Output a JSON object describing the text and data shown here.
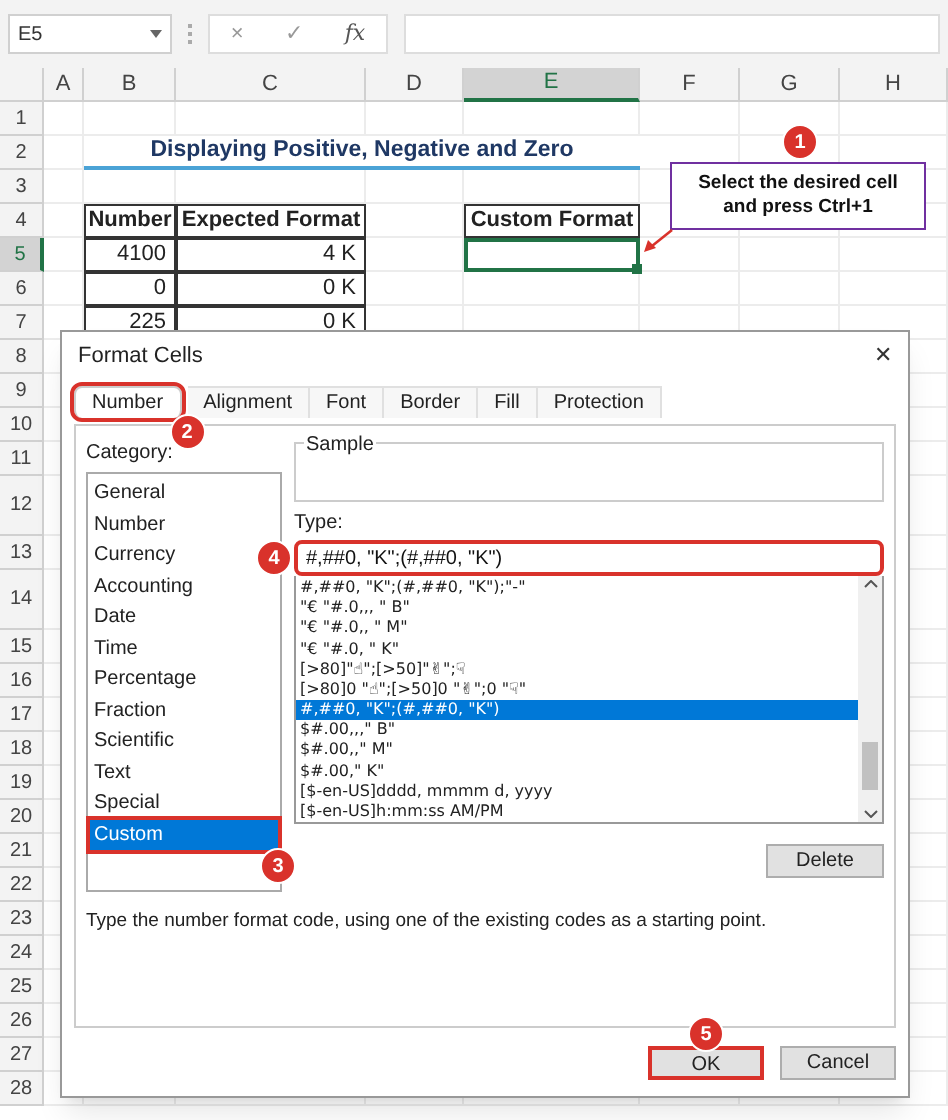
{
  "formula_bar": {
    "name_box": "E5",
    "cancel": "×",
    "enter": "✓",
    "function": "fx"
  },
  "sheet": {
    "columns": [
      {
        "label": "A",
        "selected": false
      },
      {
        "label": "B",
        "selected": false
      },
      {
        "label": "C",
        "selected": false
      },
      {
        "label": "D",
        "selected": false
      },
      {
        "label": "E",
        "selected": true
      },
      {
        "label": "F",
        "selected": false
      },
      {
        "label": "G",
        "selected": false
      },
      {
        "label": "H",
        "selected": false
      }
    ],
    "rows": [
      {
        "label": "1",
        "selected": false
      },
      {
        "label": "2",
        "selected": false
      },
      {
        "label": "3",
        "selected": false
      },
      {
        "label": "4",
        "selected": false
      },
      {
        "label": "5",
        "selected": true
      },
      {
        "label": "6",
        "selected": false
      },
      {
        "label": "7",
        "selected": false
      },
      {
        "label": "8",
        "selected": false
      },
      {
        "label": "9",
        "selected": false
      },
      {
        "label": "10",
        "selected": false
      },
      {
        "label": "11",
        "selected": false
      },
      {
        "label": "12",
        "selected": false
      },
      {
        "label": "13",
        "selected": false
      },
      {
        "label": "14",
        "selected": false
      },
      {
        "label": "15",
        "selected": false
      },
      {
        "label": "16",
        "selected": false
      },
      {
        "label": "17",
        "selected": false
      },
      {
        "label": "18",
        "selected": false
      },
      {
        "label": "19",
        "selected": false
      },
      {
        "label": "20",
        "selected": false
      },
      {
        "label": "21",
        "selected": false
      },
      {
        "label": "22",
        "selected": false
      },
      {
        "label": "23",
        "selected": false
      },
      {
        "label": "24",
        "selected": false
      },
      {
        "label": "25",
        "selected": false
      },
      {
        "label": "26",
        "selected": false
      },
      {
        "label": "27",
        "selected": false
      },
      {
        "label": "28",
        "selected": false
      }
    ],
    "title": "Displaying Positive, Negative and Zero",
    "table": {
      "columns": [
        "Number",
        "Expected Format"
      ],
      "rows": [
        [
          "4100",
          "4 K"
        ],
        [
          "0",
          "0 K"
        ],
        [
          "225",
          "0 K"
        ]
      ]
    },
    "custom_format": {
      "header": "Custom Format",
      "value_selected": true
    }
  },
  "note": {
    "callout": "1",
    "text": "Select the desired cell and press Ctrl+1"
  },
  "dialog": {
    "title": "Format Cells",
    "close": "✕",
    "tabs": [
      {
        "label": "Number",
        "selected": true,
        "highlighted": true,
        "callout": "2"
      },
      {
        "label": "Alignment",
        "selected": false,
        "highlighted": false
      },
      {
        "label": "Font",
        "selected": false,
        "highlighted": false
      },
      {
        "label": "Border",
        "selected": false,
        "highlighted": false
      },
      {
        "label": "Fill",
        "selected": false,
        "highlighted": false
      },
      {
        "label": "Protection",
        "selected": false,
        "highlighted": false
      }
    ],
    "category_label": "Category:",
    "categories": [
      {
        "label": "General",
        "selected": false,
        "highlighted": false
      },
      {
        "label": "Number",
        "selected": false,
        "highlighted": false
      },
      {
        "label": "Currency",
        "selected": false,
        "highlighted": false
      },
      {
        "label": "Accounting",
        "selected": false,
        "highlighted": false
      },
      {
        "label": "Date",
        "selected": false,
        "highlighted": false
      },
      {
        "label": "Time",
        "selected": false,
        "highlighted": false
      },
      {
        "label": "Percentage",
        "selected": false,
        "highlighted": false
      },
      {
        "label": "Fraction",
        "selected": false,
        "highlighted": false
      },
      {
        "label": "Scientific",
        "selected": false,
        "highlighted": false
      },
      {
        "label": "Text",
        "selected": false,
        "highlighted": false
      },
      {
        "label": "Special",
        "selected": false,
        "highlighted": false
      },
      {
        "label": "Custom",
        "selected": true,
        "highlighted": true,
        "callout": "3"
      }
    ],
    "sample_label": "Sample",
    "type_label": "Type:",
    "type_field": {
      "value": "#,##0, \"K\";(#,##0, \"K\")",
      "highlighted": true,
      "callout": "4"
    },
    "formats": [
      {
        "label": "#,##0, \"K\";(#,##0, \"K\");\"-\"",
        "selected": false
      },
      {
        "label": "\"€ \"#.0,,, \" B\"",
        "selected": false
      },
      {
        "label": "\"€ \"#.0,, \" M\"",
        "selected": false
      },
      {
        "label": "\"€ \"#.0, \" K\"",
        "selected": false
      },
      {
        "label": "[>80]\"☝\";[>50]\"✌\";☟",
        "selected": false
      },
      {
        "label": "[>80]0 \"☝\";[>50]0 \"✌\";0 \"☟\"",
        "selected": false
      },
      {
        "label": "#,##0, \"K\";(#,##0, \"K\")",
        "selected": true
      },
      {
        "label": "$#.00,,,\" B\"",
        "selected": false
      },
      {
        "label": "$#.00,,\" M\"",
        "selected": false
      },
      {
        "label": "$#.00,\" K\"",
        "selected": false
      },
      {
        "label": "[$-en-US]dddd, mmmm d, yyyy",
        "selected": false
      },
      {
        "label": "[$-en-US]h:mm:ss AM/PM",
        "selected": false
      }
    ],
    "delete_button": "Delete",
    "help": "Type the number format code, using one of the existing codes as a starting point.",
    "buttons": [
      {
        "label": "OK",
        "highlighted": true,
        "callout": "5"
      },
      {
        "label": "Cancel",
        "highlighted": false
      }
    ]
  }
}
